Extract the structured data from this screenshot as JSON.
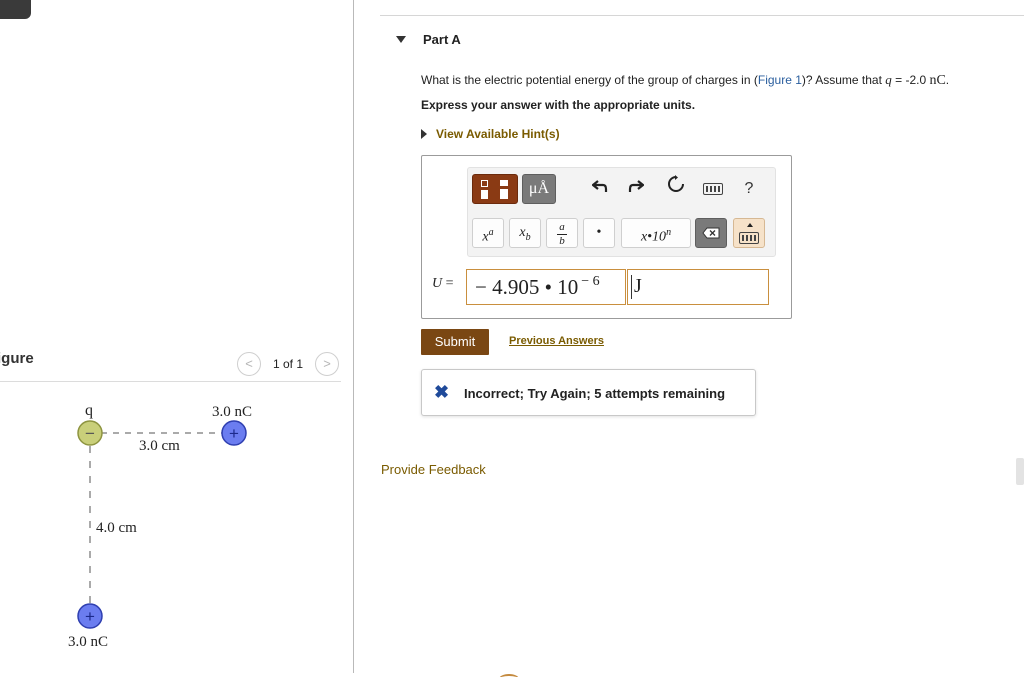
{
  "figure_panel": {
    "label": "igure",
    "pager": {
      "prev_icon": "chevron-left-icon",
      "next_icon": "chevron-right-icon",
      "count": "1 of 1"
    },
    "diagram": {
      "charge_q_label": "q",
      "charge_q_sign": "−",
      "charge_q_color": "#c9cf7a",
      "charge_right_label": "3.0 nC",
      "charge_right_sign": "+",
      "charge_bottom_label": "3.0 nC",
      "charge_bottom_sign": "+",
      "positive_color": "#6b7df0",
      "horizontal_distance": "3.0 cm",
      "vertical_distance": "4.0 cm"
    }
  },
  "part": {
    "title": "Part A",
    "question": {
      "before_link": "What is the electric potential energy of the group of charges in (",
      "link": "Figure 1",
      "after_link": ")? Assume that ",
      "variable": "q",
      "equals": " = -2.0 ",
      "unit": "nC",
      "end": "."
    },
    "instruction": "Express your answer with the appropriate units.",
    "hints_label": "View Available Hint(s)",
    "toolbar": {
      "units_icon": "templates-icon",
      "unit_symbol": "μÅ",
      "undo_icon": "undo-icon",
      "redo_icon": "redo-icon",
      "reset_icon": "reset-icon",
      "keyboard_icon": "keyboard-icon",
      "help_label": "?",
      "superscript_label": "x",
      "superscript_exp": "a",
      "subscript_label": "x",
      "subscript_sub": "b",
      "fraction_top": "a",
      "fraction_bottom": "b",
      "dot_label": "•",
      "sci_label": "x•10",
      "sci_exp": "n",
      "backspace_icon": "backspace-icon",
      "keyboard_up_icon": "keyboard-toggle-icon"
    },
    "answer": {
      "variable": "U",
      "equals": " =",
      "value": "− 4.905 • 10",
      "exponent": "− 6",
      "unit": "J"
    },
    "submit_label": "Submit",
    "previous_answers_label": "Previous Answers",
    "feedback": {
      "icon": "x-mark-icon",
      "mark": "✖",
      "message": "Incorrect; Try Again; 5 attempts remaining"
    }
  },
  "provide_feedback_label": "Provide Feedback",
  "colors": {
    "accent_brown": "#7a4713",
    "hint_gold": "#7a5b00",
    "link_blue": "#2a5e9e",
    "incorrect_blue": "#1f4a9a"
  }
}
